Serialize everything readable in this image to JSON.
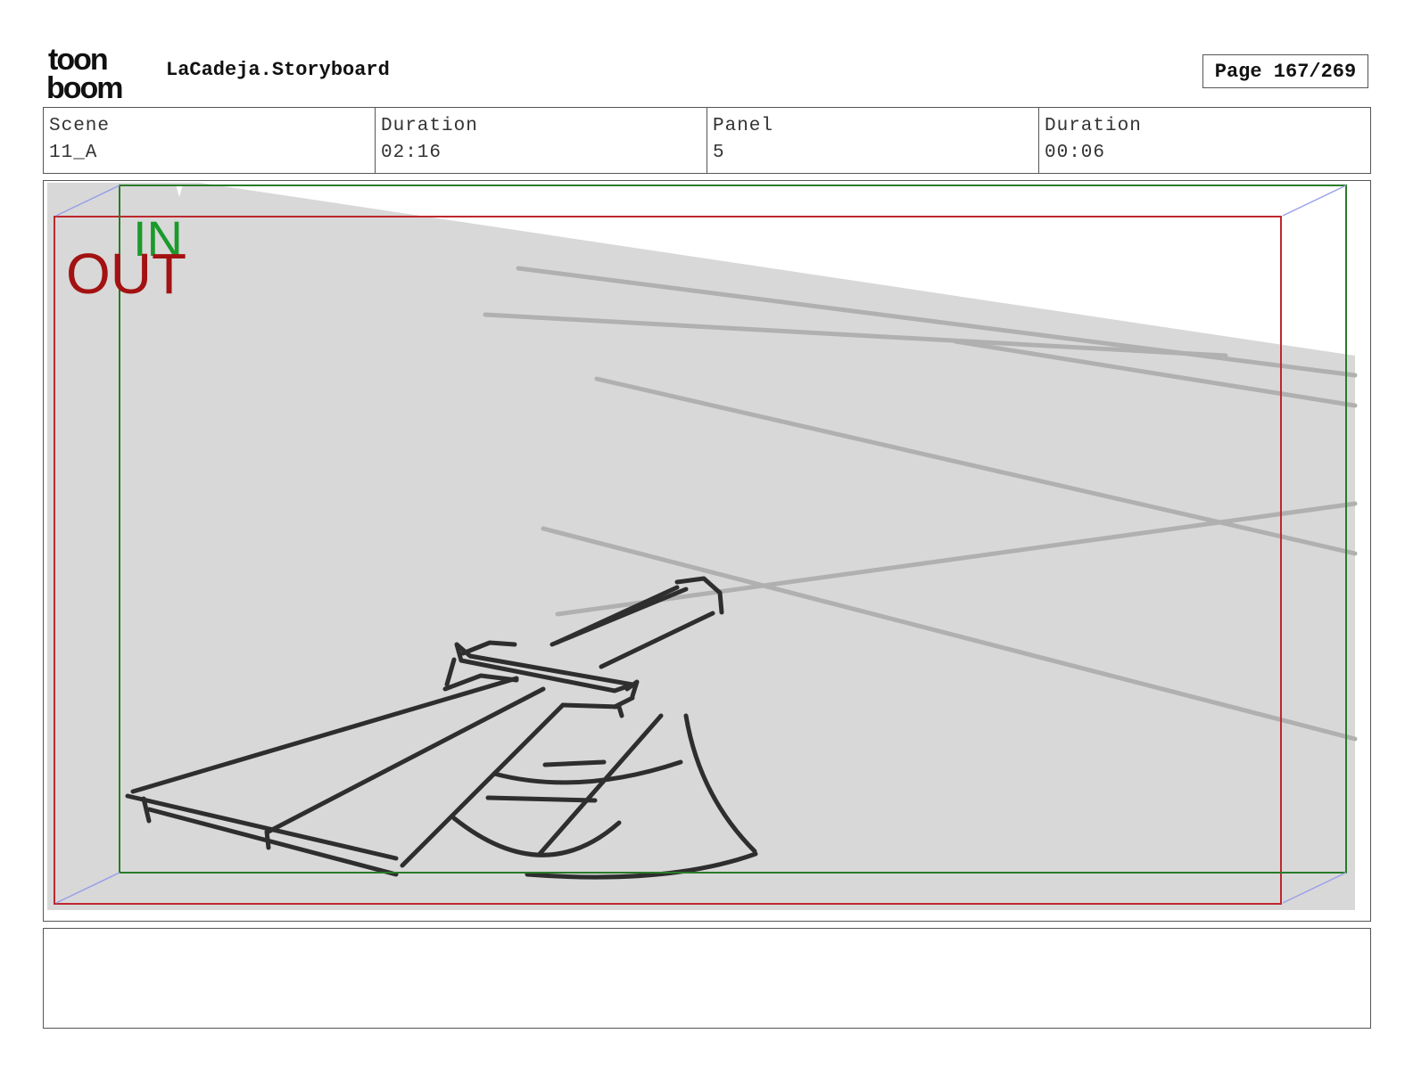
{
  "header": {
    "logo_line1": "toon",
    "logo_line2": "boom",
    "project_title": "LaCadeja.Storyboard",
    "page_label": "Page 167/269"
  },
  "info": {
    "scene_label": "Scene",
    "scene_value": "11_A",
    "scene_duration_label": "Duration",
    "scene_duration_value": "02:16",
    "panel_label": "Panel",
    "panel_value": "5",
    "panel_duration_label": "Duration",
    "panel_duration_value": "00:06"
  },
  "panel": {
    "in_label": "IN",
    "out_label": "OUT",
    "in_color": "#1a9a2a",
    "out_color": "#a31212",
    "background": "#d8d8d8"
  },
  "caption": {
    "text": ""
  }
}
